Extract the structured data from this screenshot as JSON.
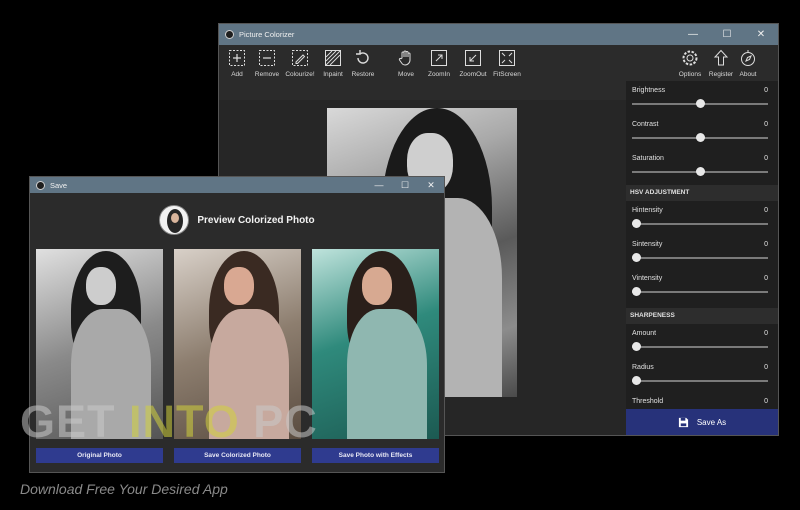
{
  "main_window": {
    "title": "Picture Colorizer",
    "controls": {
      "minimize": "—",
      "maximize": "☐",
      "close": "✕"
    },
    "tools": [
      {
        "label": "Add",
        "icon": "add-box-icon"
      },
      {
        "label": "Remove",
        "icon": "remove-box-icon"
      },
      {
        "label": "Colourize!",
        "icon": "colourize-icon"
      },
      {
        "label": "Inpaint",
        "icon": "inpaint-icon"
      },
      {
        "label": "Restore",
        "icon": "restore-icon"
      },
      {
        "label": "Move",
        "icon": "hand-icon"
      },
      {
        "label": "ZoomIn",
        "icon": "zoom-in-icon"
      },
      {
        "label": "ZoomOut",
        "icon": "zoom-out-icon"
      },
      {
        "label": "FitScreen",
        "icon": "fit-screen-icon"
      }
    ],
    "right_tools": [
      {
        "label": "Options",
        "icon": "gear-icon"
      },
      {
        "label": "Register",
        "icon": "arrow-up-icon"
      },
      {
        "label": "About",
        "icon": "compass-icon"
      }
    ],
    "panel": {
      "basic": [
        {
          "label": "Brightness",
          "value": "0",
          "level": 0.5
        },
        {
          "label": "Contrast",
          "value": "0",
          "level": 0.5
        },
        {
          "label": "Saturation",
          "value": "0",
          "level": 0.5
        }
      ],
      "hsv_heading": "HSV ADJUSTMENT",
      "hsv": [
        {
          "label": "Hintensity",
          "value": "0",
          "level": 0
        },
        {
          "label": "Sintensity",
          "value": "0",
          "level": 0
        },
        {
          "label": "Vintensity",
          "value": "0",
          "level": 0
        }
      ],
      "sharpness_heading": "SHARPENESS",
      "sharpness": [
        {
          "label": "Amount",
          "value": "0",
          "level": 0
        },
        {
          "label": "Radius",
          "value": "0",
          "level": 0
        },
        {
          "label": "Threshold",
          "value": "0",
          "level": 0
        }
      ],
      "save_as": "Save As"
    }
  },
  "save_dialog": {
    "title": "Save",
    "controls": {
      "minimize": "—",
      "maximize": "☐",
      "close": "✕"
    },
    "heading": "Preview Colorized Photo",
    "buttons": {
      "original": "Original Photo",
      "colorized": "Save Colorized Photo",
      "effects": "Save Photo with Effects"
    }
  },
  "watermark": {
    "get": "GET ",
    "into": "INTO",
    "pc": " PC",
    "tagline": "Download Free Your Desired App"
  }
}
